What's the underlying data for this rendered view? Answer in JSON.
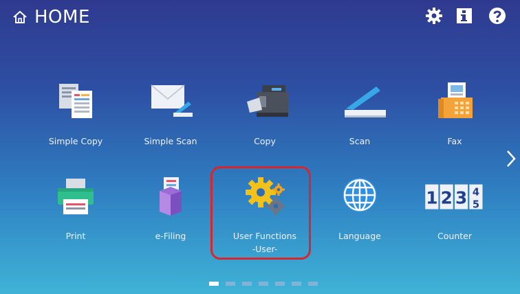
{
  "header": {
    "title": "HOME",
    "icons": [
      "home-icon",
      "gear-icon",
      "info-icon",
      "help-icon"
    ]
  },
  "tiles": [
    {
      "label": "Simple Copy",
      "icon": "simple-copy-icon"
    },
    {
      "label": "Simple Scan",
      "icon": "simple-scan-icon"
    },
    {
      "label": "Copy",
      "icon": "copier-icon"
    },
    {
      "label": "Scan",
      "icon": "scanner-icon"
    },
    {
      "label": "Fax",
      "icon": "fax-icon"
    },
    {
      "label": "Print",
      "icon": "printer-icon"
    },
    {
      "label": "e-Filing",
      "icon": "e-filing-box-icon"
    },
    {
      "label": "User Functions",
      "sublabel": "-User-",
      "icon": "gears-icon",
      "highlighted": true
    },
    {
      "label": "Language",
      "icon": "globe-icon"
    },
    {
      "label": "Counter",
      "icon": "counter-digits-icon",
      "digits": [
        "1",
        "2",
        "3",
        "4",
        "5"
      ]
    }
  ],
  "pager": {
    "pages": 7,
    "current": 1
  },
  "colors": {
    "highlight": "#d8262e",
    "bg_top": "#2f3a8f",
    "bg_bottom": "#3fb3d6"
  }
}
